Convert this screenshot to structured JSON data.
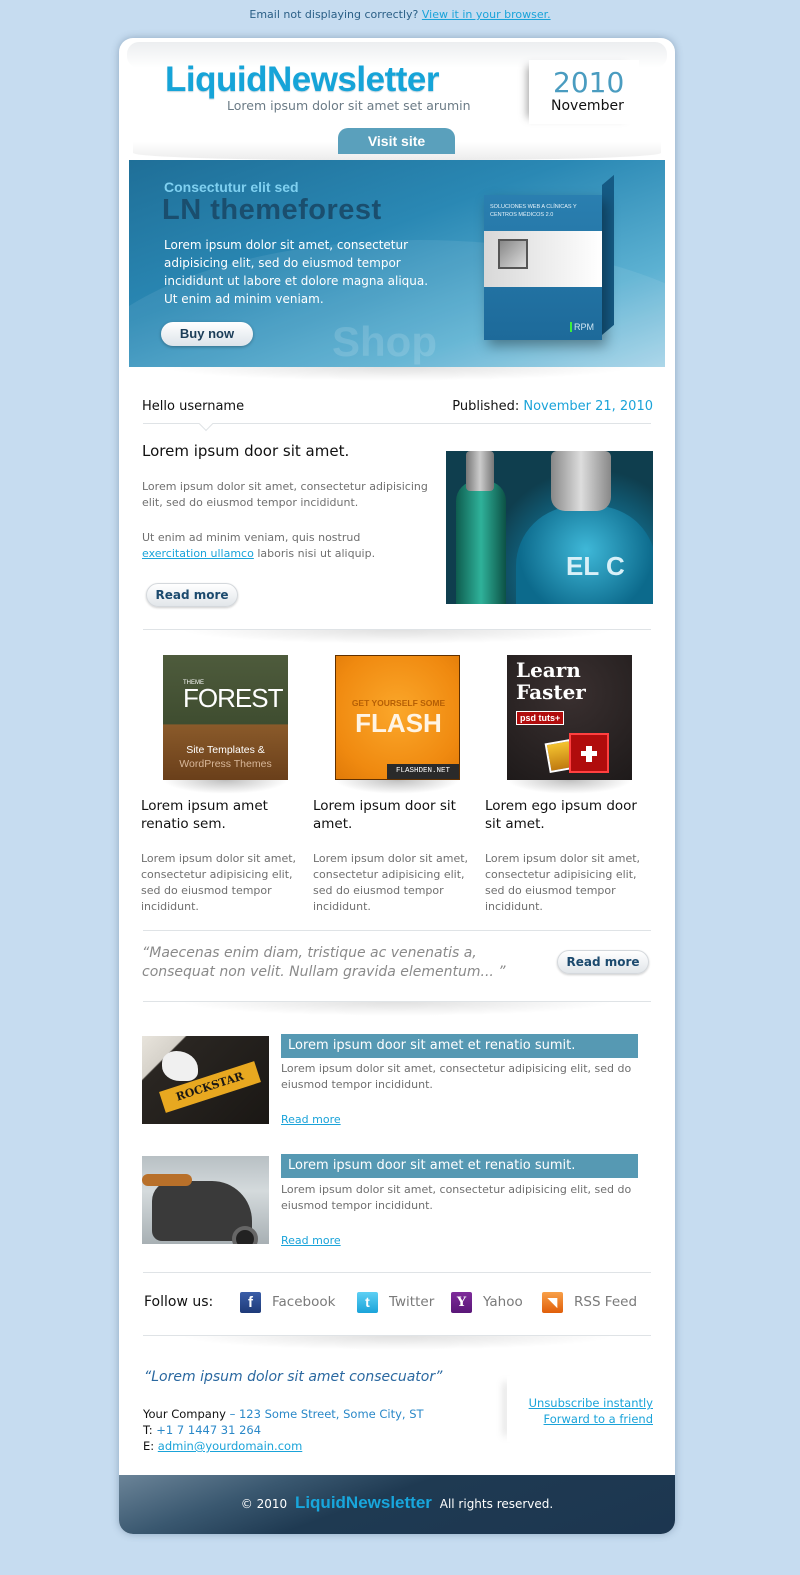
{
  "preheader": {
    "text": "Email not displaying correctly?",
    "link": "View it in your browser."
  },
  "header": {
    "logo": "LiquidNewsletter",
    "tagline": "Lorem ipsum dolor sit amet set arumin",
    "year": "2010",
    "month": "November",
    "visit_site": "Visit site"
  },
  "hero": {
    "kicker": "Consectutur elit sed",
    "title": "LN themeforest",
    "text": "Lorem ipsum dolor sit amet, consectetur adipisicing elit, sed do eiusmod tempor incididunt ut labore et dolore magna aliqua. Ut enim ad minim veniam.",
    "button": "Buy now",
    "watermark": "Shop",
    "box_label": "SOLUCIONES WEB A CLÍNICAS Y CENTROS MÉDICOS 2.0",
    "box_brand": "RPM"
  },
  "greeting": {
    "hello": "Hello username",
    "published_label": "Published:",
    "published_date": "November 21, 2010"
  },
  "feature": {
    "title": "Lorem ipsum door sit amet.",
    "p1": "Lorem ipsum dolor sit amet, consectetur adipisicing elit, sed do eiusmod tempor incididunt.",
    "p2_before": "Ut enim ad minim veniam, quis nostrud",
    "p2_link": "exercitation ullamco",
    "p2_after": "laboris nisi ut aliquip.",
    "read_more": "Read more",
    "image_text": "EL C"
  },
  "columns": [
    {
      "image": {
        "small": "THEME",
        "big": "FOREST",
        "line1": "Site Templates &",
        "line2": "WordPress Themes"
      },
      "title": "Lorem ipsum amet renatio sem.",
      "text": "Lorem ipsum dolor sit amet, consectetur adipisicing elit, sed do eiusmod tempor incididunt."
    },
    {
      "image": {
        "small": "GET YOURSELF SOME",
        "big": "FLASH",
        "tag": "FLASHDEN.NET"
      },
      "title": "Lorem ipsum door sit amet.",
      "text": "Lorem ipsum dolor sit amet, consectetur adipisicing elit, sed do eiusmod tempor incididunt."
    },
    {
      "image": {
        "big": "Learn Faster",
        "tag": "psd tuts+"
      },
      "title": "Lorem ego ipsum door sit amet.",
      "text": "Lorem ipsum dolor sit amet, consectetur adipisicing elit, sed do eiusmod tempor incididunt."
    }
  ],
  "quote": {
    "text": "“Maecenas enim diam, tristique ac venenatis a, consequat non velit. Nullam gravida elementum... ”",
    "read_more": "Read more"
  },
  "rows": [
    {
      "image_text": "ROCKSTAR",
      "title": "Lorem ipsum door sit amet et renatio sumit.",
      "text": "Lorem ipsum dolor sit amet, consectetur adipisicing elit, sed do eiusmod tempor incididunt.",
      "link": "Read more"
    },
    {
      "title": "Lorem ipsum door sit amet et renatio sumit.",
      "text": "Lorem ipsum dolor sit amet, consectetur adipisicing elit, sed do eiusmod tempor incididunt.",
      "link": "Read more"
    }
  ],
  "social": {
    "label": "Follow us:",
    "items": [
      {
        "name": "Facebook",
        "glyph": "f"
      },
      {
        "name": "Twitter",
        "glyph": "t"
      },
      {
        "name": "Yahoo",
        "glyph": "Y"
      },
      {
        "name": "RSS Feed",
        "glyph": "◥"
      }
    ]
  },
  "contact": {
    "slogan": "“Lorem ipsum dolor sit amet consecuator”",
    "company": "Your Company",
    "address": " – 123 Some Street, Some City, ST",
    "phone_label": "T:",
    "phone": "+1 7 1447 31 264",
    "email_label": "E:",
    "email": "admin@yourdomain.com",
    "unsubscribe": "Unsubscribe instantly",
    "forward": "Forward to a friend"
  },
  "footer": {
    "copyright": "© 2010",
    "logo": "LiquidNewsletter",
    "rights": "All rights reserved."
  },
  "colors": {
    "background": "#c6dcf0",
    "accent": "#1aa3d9",
    "bar": "#5699b3",
    "footer": "#1f3a52"
  }
}
